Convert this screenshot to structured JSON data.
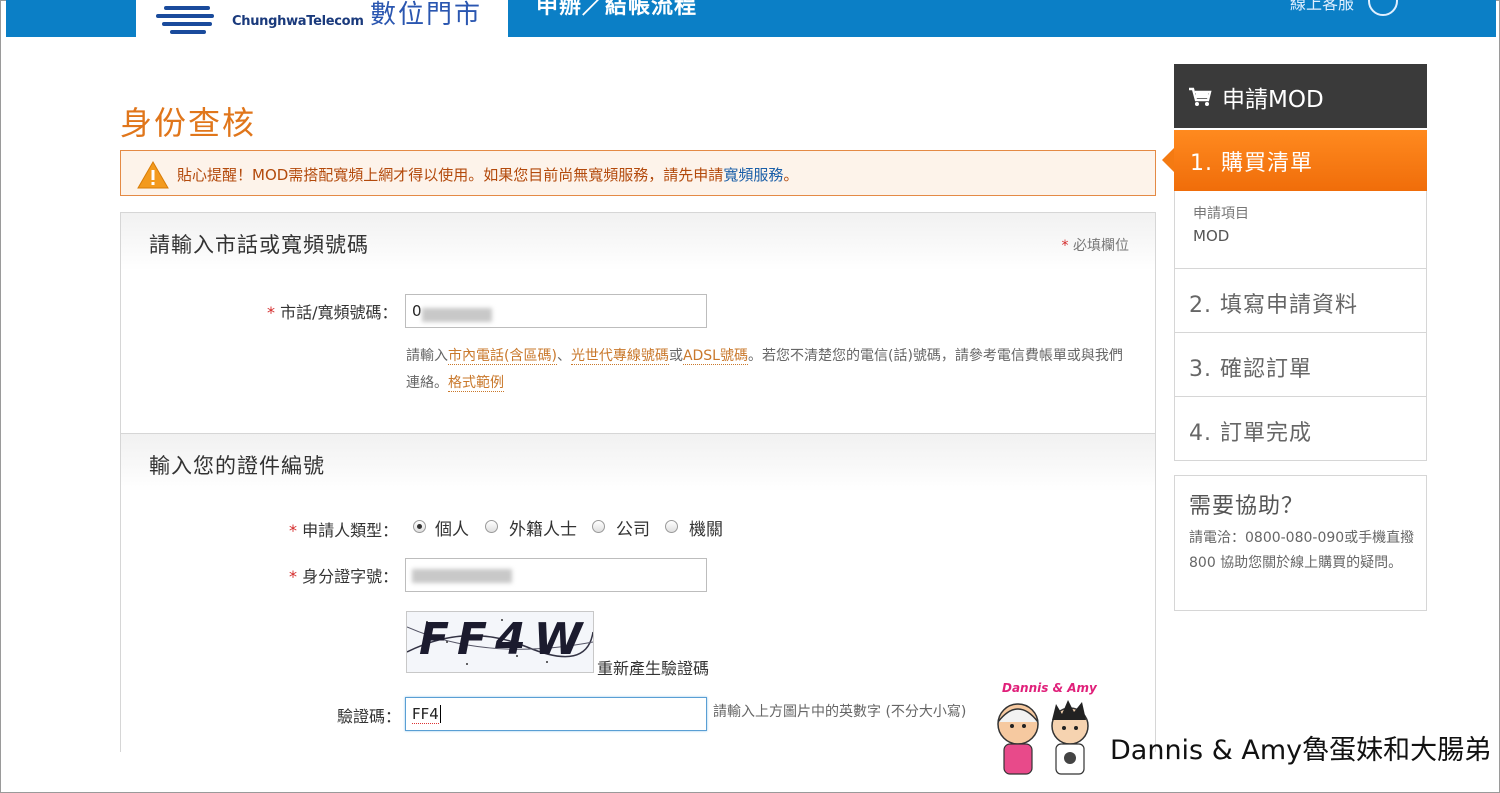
{
  "header": {
    "logo_en": "ChunghwaTelecom",
    "logo_cn": "數位門市",
    "title": "申辦／結帳流程",
    "right_text": "線上客服"
  },
  "page": {
    "title": "身份查核"
  },
  "alert": {
    "text": "貼心提醒！MOD需搭配寬頻上網才得以使用。如果您目前尚無寬頻服務，請先申請",
    "link": "寬頻服務",
    "suffix": "。"
  },
  "section1": {
    "title": "請輸入市話或寬頻號碼",
    "required_note": "必填欄位",
    "phone_label": "市話/寬頻號碼：",
    "phone_value": "0",
    "hint_prefix": "請輸入",
    "hint_link1": "市內電話(含區碼)",
    "hint_sep1": "、",
    "hint_link2": "光世代專線號碼",
    "hint_or": "或",
    "hint_link3": "ADSL號碼",
    "hint_middle": "。若您不清楚您的電信(話)號碼，請參考電信費帳單或與我們連絡。",
    "hint_link4": "格式範例"
  },
  "section2": {
    "title": "輸入您的證件編號",
    "type_label": "申請人類型：",
    "types": [
      "個人",
      "外籍人士",
      "公司",
      "機關"
    ],
    "selected_type": "個人",
    "id_label": "身分證字號：",
    "captcha_image_text": "FF4W",
    "refresh_label": "重新產生驗證碼",
    "captcha_label": "驗證碼：",
    "captcha_value": "FF4",
    "captcha_hint": "請輸入上方圖片中的英數字 (不分大小寫)"
  },
  "sidebar": {
    "title": "申請MOD",
    "steps": [
      "1. 購買清單",
      "2. 填寫申請資料",
      "3. 確認訂單",
      "4. 訂單完成"
    ],
    "active_step": 1,
    "item_label": "申請項目",
    "item_value": "MOD",
    "help_title": "需要協助？",
    "help_text": "請電洽：0800-080-090或手機直撥800 協助您關於線上購買的疑問。"
  },
  "watermark": {
    "brand": "Dannis & Amy",
    "text": "Dannis & Amy魯蛋妹和大腸弟"
  },
  "colors": {
    "accent": "#e0761b",
    "topbar": "#0b7fc6",
    "active_step": "#f47a12"
  }
}
